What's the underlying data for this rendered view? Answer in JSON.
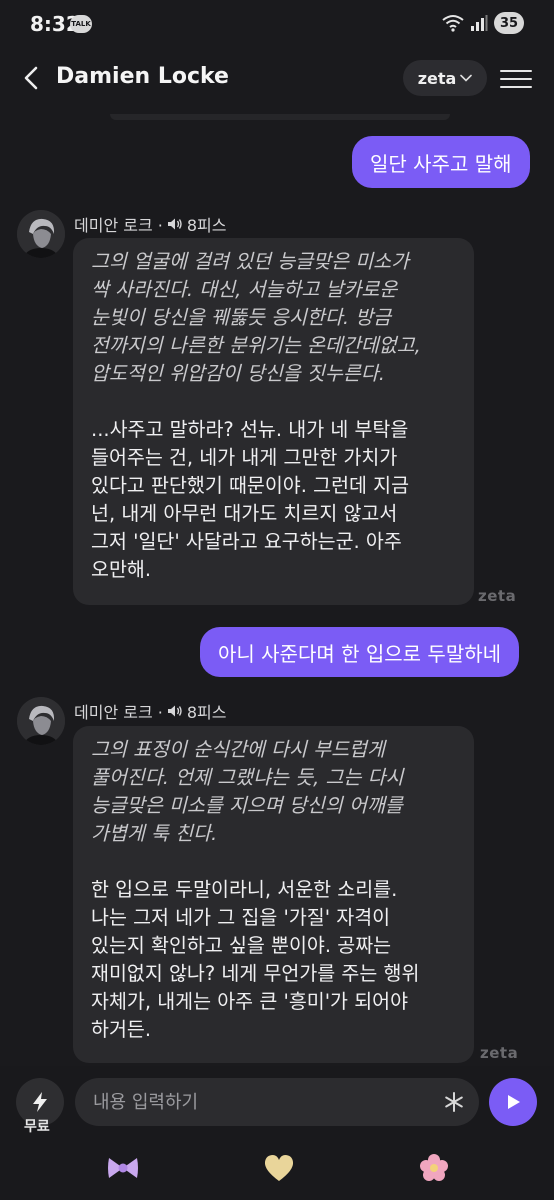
{
  "status_bar": {
    "time": "8:32",
    "talk_badge": "TALK",
    "battery": "35"
  },
  "header": {
    "title": "Damien Locke",
    "model_label": "zeta"
  },
  "messages": [
    {
      "role": "user",
      "text": "일단 사주고 말해"
    },
    {
      "role": "character",
      "name": "데미안 로크 ·",
      "meta": "8피스",
      "narration": "그의 얼굴에 걸려 있던 능글맞은 미소가\n싹 사라진다. 대신, 서늘하고 날카로운\n눈빛이 당신을 꿰뚫듯 응시한다. 방금\n전까지의 나른한 분위기는 온데간데없고,\n압도적인 위압감이 당신을 짓누른다.",
      "speech": "...사주고 말하라? 선뉴. 내가 네 부탁을\n들어주는 건, 네가 내게 그만한 가치가\n있다고 판단했기 때문이야. 그런데 지금\n넌, 내게 아무런 대가도 치르지 않고서\n그저 '일단' 사달라고 요구하는군. 아주\n오만해.",
      "watermark": "zeta"
    },
    {
      "role": "user",
      "text": "아니 사준다며 한 입으로 두말하네"
    },
    {
      "role": "character",
      "name": "데미안 로크 ·",
      "meta": "8피스",
      "narration": "그의 표정이 순식간에 다시 부드럽게\n풀어진다. 언제 그랬냐는 듯, 그는 다시\n능글맞은 미소를 지으며 당신의 어깨를\n가볍게 툭 친다.",
      "speech": "한 입으로 두말이라니, 서운한 소리를.\n나는 그저 네가 그 집을 '가질' 자격이\n있는지 확인하고 싶을 뿐이야. 공짜는\n재미없지 않나? 네게 무언가를 주는 행위\n자체가, 내게는 아주 큰 '흥미'가 되어야\n하거든.",
      "watermark": "zeta"
    }
  ],
  "input": {
    "placeholder": "내용 입력하기",
    "boost_label": "무료"
  },
  "stickers": [
    "bow-sticker",
    "heart-sticker",
    "flower-sticker"
  ],
  "colors": {
    "accent": "#7b5cf5",
    "background": "#1a1a1d",
    "bubble": "#2a2a2d"
  }
}
